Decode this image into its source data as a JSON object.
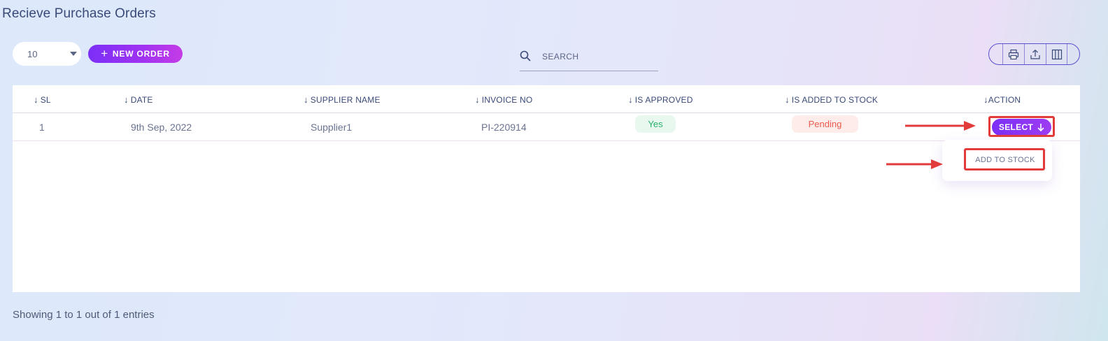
{
  "page": {
    "title": "Recieve Purchase Orders"
  },
  "toolbar": {
    "entries_value": "10",
    "new_order_label": "NEW ORDER",
    "search_placeholder": "SEARCH"
  },
  "table": {
    "columns": [
      "SL",
      "DATE",
      "SUPPLIER NAME",
      "INVOICE NO",
      "IS APPROVED",
      "IS ADDED TO STOCK",
      "ACTION"
    ],
    "rows": [
      {
        "sl": "1",
        "date": "9th Sep, 2022",
        "supplier": "Supplier1",
        "invoice": "PI-220914",
        "approved": "Yes",
        "stock_status": "Pending",
        "action_label": "SELECT"
      }
    ]
  },
  "dropdown": {
    "items": [
      "ADD TO STOCK"
    ]
  },
  "footer": {
    "summary": "Showing 1 to 1 out of 1 entries"
  },
  "colors": {
    "accent": "#7b2ff7",
    "approved_bg": "#e8f8ef",
    "approved_text": "#27b26a",
    "pending_bg": "#fdecea",
    "pending_text": "#ec5a4f",
    "annotation_red": "#e23b3b"
  },
  "icons": {
    "search": "search-icon",
    "print": "print-icon",
    "export": "export-icon",
    "columns": "columns-icon",
    "sort": "sort-arrow-icon"
  }
}
